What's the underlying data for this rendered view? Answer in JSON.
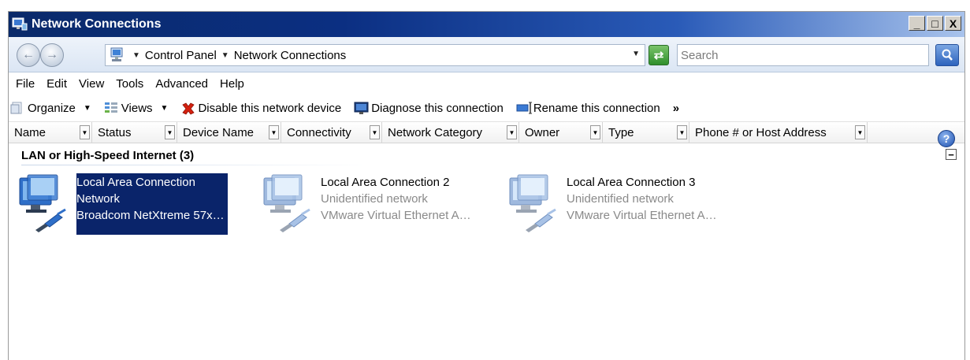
{
  "window": {
    "title": "Network Connections",
    "caption_buttons": [
      "_",
      "□",
      "X"
    ]
  },
  "address": {
    "breadcrumbs": [
      "Control Panel",
      "Network Connections"
    ],
    "search_placeholder": "Search"
  },
  "menu": {
    "items": [
      "File",
      "Edit",
      "View",
      "Tools",
      "Advanced",
      "Help"
    ]
  },
  "commands": {
    "organize": "Organize",
    "views": "Views",
    "disable": "Disable this network device",
    "diagnose": "Diagnose this connection",
    "rename": "Rename this connection",
    "more": "»"
  },
  "columns": [
    {
      "label": "Name"
    },
    {
      "label": "Status"
    },
    {
      "label": "Device Name"
    },
    {
      "label": "Connectivity"
    },
    {
      "label": "Network Category"
    },
    {
      "label": "Owner"
    },
    {
      "label": "Type"
    },
    {
      "label": "Phone # or Host Address"
    }
  ],
  "group": {
    "title": "LAN or High-Speed Internet (3)",
    "collapse_glyph": "−"
  },
  "connections": [
    {
      "name": "Local Area Connection",
      "status": "Network",
      "device": "Broadcom NetXtreme 57x…",
      "selected": true
    },
    {
      "name": "Local Area Connection 2",
      "status": "Unidentified network",
      "device": "VMware Virtual Ethernet A…",
      "selected": false
    },
    {
      "name": "Local Area Connection 3",
      "status": "Unidentified network",
      "device": "VMware Virtual Ethernet A…",
      "selected": false
    }
  ],
  "colors": {
    "title_start": "#0a2a6a",
    "selection": "#0a246a",
    "disable_icon": "#d4200f"
  },
  "icons": {
    "app": "network-connections-icon",
    "back": "back-arrow-icon",
    "forward": "forward-arrow-icon",
    "refresh": "refresh-icon",
    "search": "search-icon",
    "help": "help-icon",
    "connection": "network-computer-icon"
  }
}
